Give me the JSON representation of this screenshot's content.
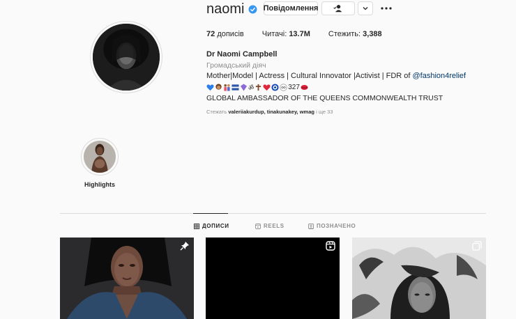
{
  "profile": {
    "username": "naomi",
    "verified": true,
    "actions": {
      "message_label": "Повідомлення",
      "follow_icon": "person-check-icon",
      "more_icon": "chevron-down-icon",
      "options_icon": "ellipsis-icon"
    },
    "stats": {
      "posts_count": "72",
      "posts_label": "дописів",
      "followers_label": "Читачі:",
      "followers_count": "13.7M",
      "following_label": "Стежить:",
      "following_count": "3,388"
    },
    "full_name": "Dr Naomi Campbell",
    "category": "Громадський діяч",
    "bio_line1_text": "Mother|Model | Actress | Cultural Innovator |Activist | FDR of ",
    "bio_line1_link": "@fashion4relief",
    "bio_line2_count": "327",
    "bio_line3": "GLOBAL AMBASSADOR OF THE QUEENS COMMONWEALTH TRUST",
    "followed_by": {
      "prefix": "Стежать",
      "users": "valeriiakurdup, tinakunakey, wmag",
      "suffix": "і ще 33"
    }
  },
  "highlights": [
    {
      "label": "Highlights"
    }
  ],
  "tabs": [
    {
      "label": "ДОПИСИ",
      "icon": "grid-icon",
      "active": true
    },
    {
      "label": "REELS",
      "icon": "reels-icon",
      "active": false
    },
    {
      "label": "ПОЗНАЧЕНО",
      "icon": "tagged-icon",
      "active": false
    }
  ],
  "posts": [
    {
      "overlay_icon": "pin-icon"
    },
    {
      "overlay_icon": "reels-icon"
    },
    {
      "overlay_icon": "carousel-icon"
    }
  ],
  "colors": {
    "background": "#fafafa",
    "text": "#262626",
    "secondary_text": "#8e8e8e",
    "link": "#00376b",
    "verified": "#3897f0",
    "border": "#dbdbdb"
  }
}
